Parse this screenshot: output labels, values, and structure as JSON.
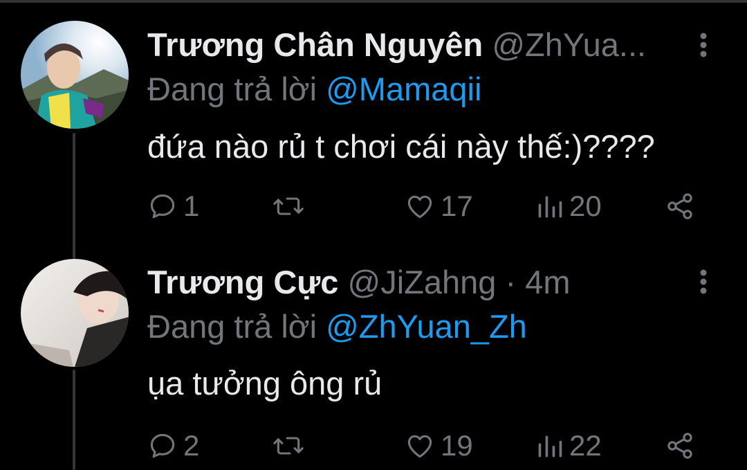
{
  "tweets": [
    {
      "name": "Trương Chân Nguyên",
      "handle": "@ZhYua...",
      "meta": "",
      "reply_prefix": "Đang trả lời",
      "reply_to": "@Mamaqii",
      "text": "đứa nào rủ t chơi cái này thế:)????",
      "stats": {
        "replies": "1",
        "retweets": "",
        "likes": "17",
        "views": "20"
      }
    },
    {
      "name": "Trương Cực",
      "handle": "@JiZahng",
      "meta": " · 4m",
      "reply_prefix": "Đang trả lời",
      "reply_to": "@ZhYuan_Zh",
      "text": "ụa tưởng ông rủ",
      "stats": {
        "replies": "2",
        "retweets": "",
        "likes": "19",
        "views": "22"
      }
    }
  ],
  "icons": {
    "reply": "reply-icon",
    "retweet": "retweet-icon",
    "like": "like-icon",
    "views": "views-icon",
    "share": "share-icon",
    "more": "more-icon"
  },
  "colors": {
    "background": "#000000",
    "text": "#e7e9ea",
    "muted": "#71767b",
    "mention": "#1d9bf0",
    "thread_line": "#333639"
  }
}
